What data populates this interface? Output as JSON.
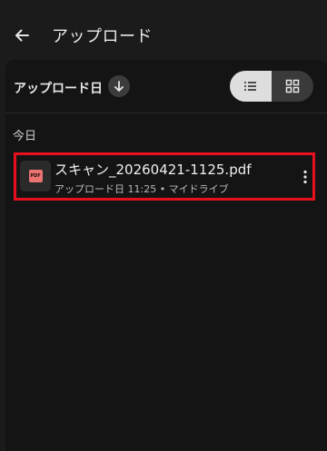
{
  "header": {
    "title": "アップロード",
    "back_icon": "arrow-left-icon"
  },
  "sort": {
    "label": "アップロード日",
    "direction_icon": "arrow-down-icon"
  },
  "view_toggle": {
    "selected": "list",
    "list_icon": "list-icon",
    "grid_icon": "grid-icon"
  },
  "sections": [
    {
      "label": "今日",
      "files": [
        {
          "name": "スキャン_20260421-1125.pdf",
          "meta": "アップロード日 11:25 • マイドライブ",
          "type_label": "PDF",
          "more_icon": "more-vert-icon"
        }
      ]
    }
  ],
  "colors": {
    "background": "#1b1b1b",
    "panel": "#141414",
    "highlight_border": "#e8101e",
    "pdf_badge": "#e97470",
    "toggle_selected": "#dedede",
    "toggle_unselected": "#3a3a3a"
  }
}
